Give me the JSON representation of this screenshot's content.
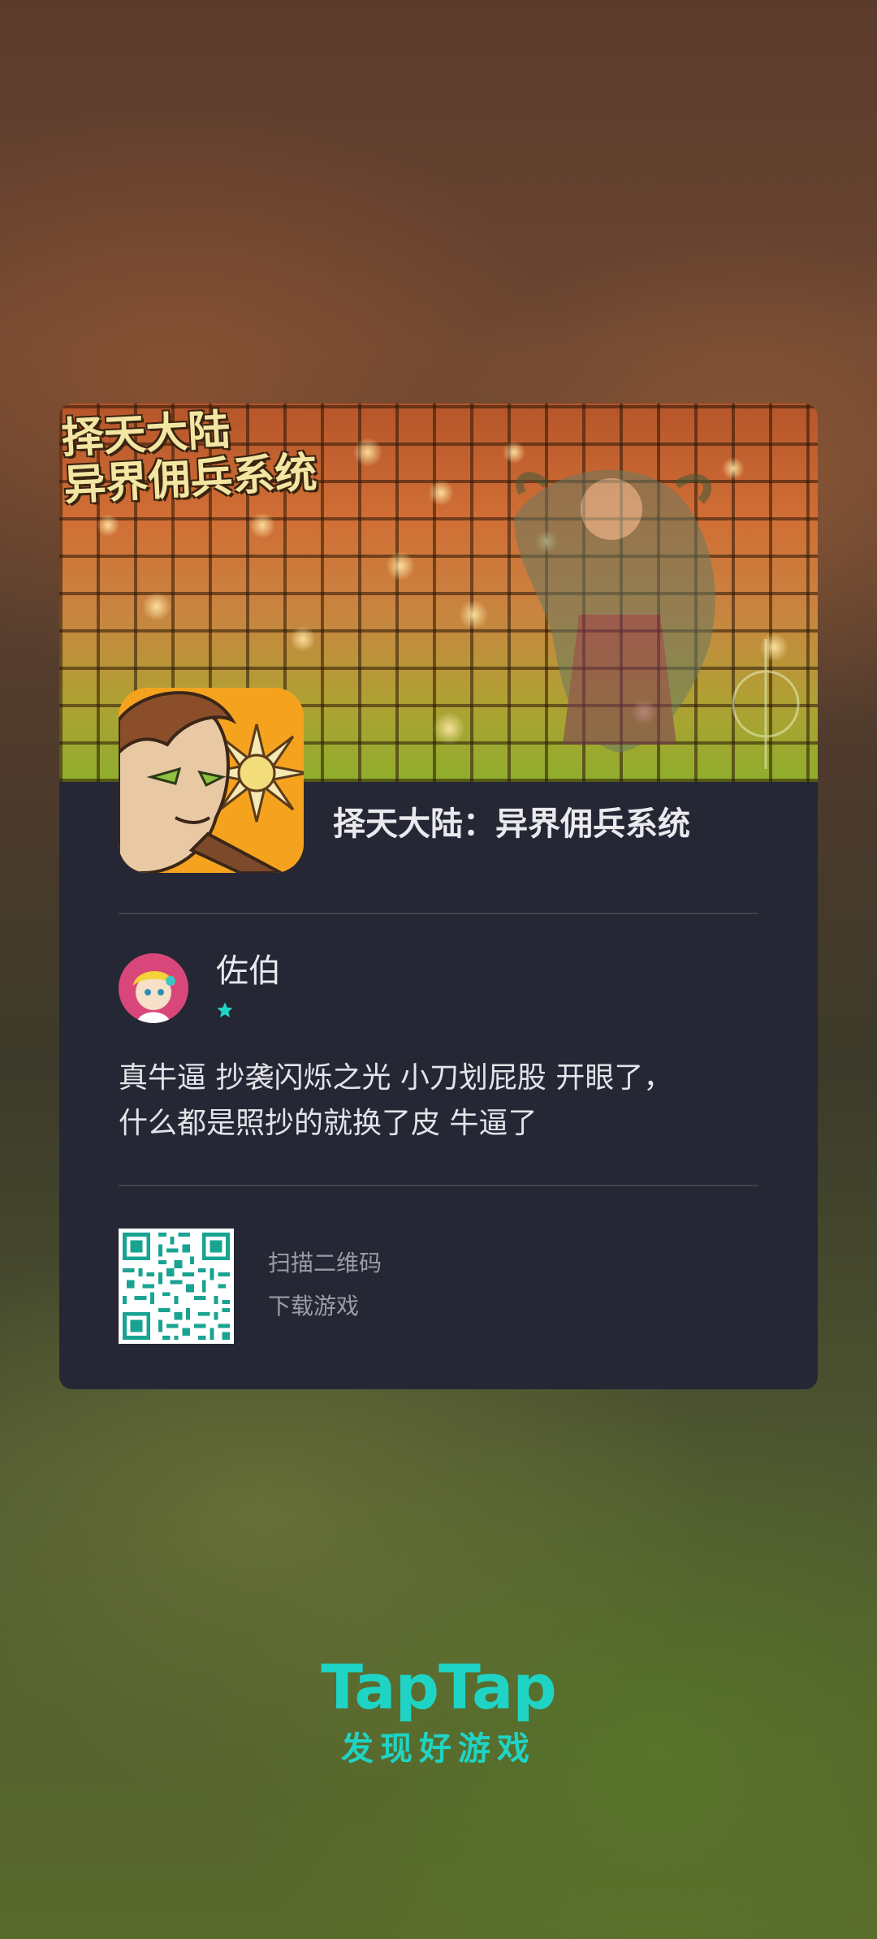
{
  "card": {
    "banner": {
      "logo_line1": "择天大陆",
      "logo_line2": "异界佣兵系统"
    },
    "app_title": "择天大陆：异界佣兵系统",
    "review": {
      "user_name": "佐伯",
      "rating_stars": 1,
      "text_line1": "真牛逼 抄袭闪烁之光 小刀划屁股 开眼了，",
      "text_line2": "什么都是照抄的就换了皮 牛逼了"
    },
    "qr": {
      "line1": "扫描二维码",
      "line2": "下载游戏"
    }
  },
  "brand": {
    "logo": "TapTap",
    "tagline": "发现好游戏"
  },
  "colors": {
    "card_bg": "#252735",
    "accent": "#1fd4c4",
    "qr_color": "#19a392"
  },
  "icons": {
    "rating": "star-icon",
    "app": "app-icon",
    "avatar": "avatar"
  }
}
